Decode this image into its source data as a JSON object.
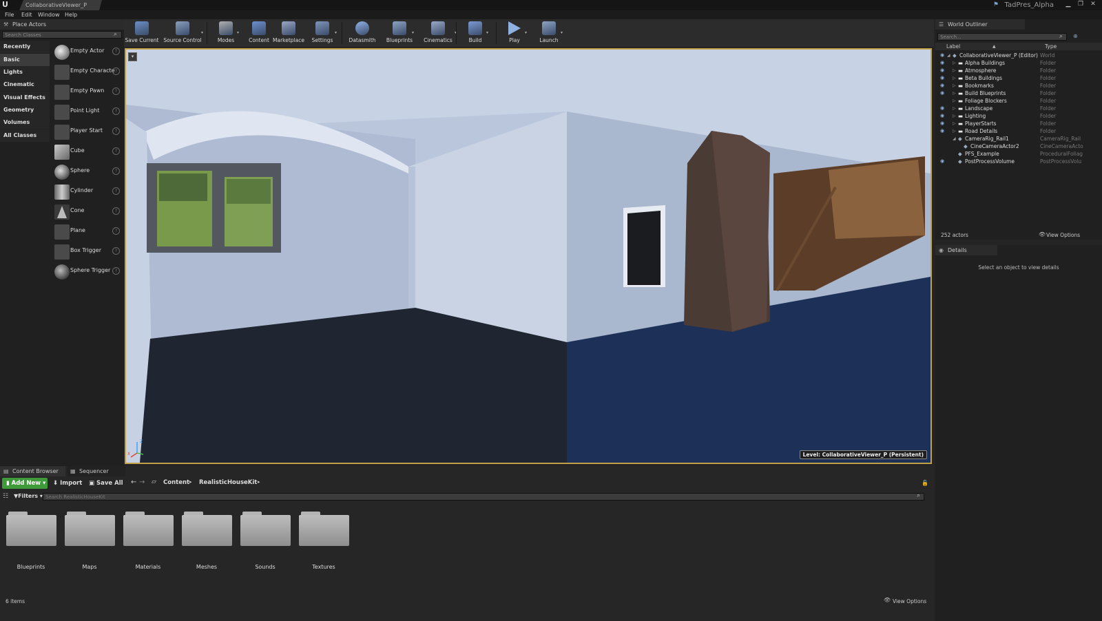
{
  "window": {
    "tab_title": "CollaborativeViewer_P",
    "project_name": "TadPres_Alpha",
    "logo": "U"
  },
  "menu": [
    "File",
    "Edit",
    "Window",
    "Help"
  ],
  "place_actors": {
    "title": "Place Actors",
    "search_placeholder": "Search Classes",
    "categories": [
      "Recently Placed",
      "Basic",
      "Lights",
      "Cinematic",
      "Visual Effects",
      "Geometry",
      "Volumes",
      "All Classes"
    ],
    "active_category": "Basic",
    "items": [
      "Empty Actor",
      "Empty Characte",
      "Empty Pawn",
      "Point Light",
      "Player Start",
      "Cube",
      "Sphere",
      "Cylinder",
      "Cone",
      "Plane",
      "Box Trigger",
      "Sphere Trigger"
    ],
    "help_glyph": "?"
  },
  "toolbar": {
    "buttons": [
      {
        "label": "Save Current",
        "icon": "save-icon",
        "color": "#6b8fc7"
      },
      {
        "label": "Source Control",
        "icon": "source-control-icon",
        "color": "#8aa0c0"
      },
      {
        "label": "Modes",
        "icon": "modes-icon",
        "color": "#b0b0b0"
      },
      {
        "label": "Content",
        "icon": "content-icon",
        "color": "#6d8fd0"
      },
      {
        "label": "Marketplace",
        "icon": "marketplace-icon",
        "color": "#9aa6c6"
      },
      {
        "label": "Settings",
        "icon": "settings-icon",
        "color": "#7f95b8"
      },
      {
        "label": "Datasmith",
        "icon": "datasmith-icon",
        "color": "#8fb2e8"
      },
      {
        "label": "Blueprints",
        "icon": "blueprints-icon",
        "color": "#8ea3c4"
      },
      {
        "label": "Cinematics",
        "icon": "cinematics-icon",
        "color": "#9aa9c8"
      },
      {
        "label": "Build",
        "icon": "build-icon",
        "color": "#7c9ad4"
      },
      {
        "label": "Play",
        "icon": "play-icon",
        "color": "#8fb0e0"
      },
      {
        "label": "Launch",
        "icon": "launch-icon",
        "color": "#8ea3c4"
      }
    ]
  },
  "viewport": {
    "level_label": "Level:  CollaborativeViewer_P (Persistent)",
    "axis_z": "Z",
    "axis_x": "X"
  },
  "outliner": {
    "title": "World Outliner",
    "search_placeholder": "Search...",
    "col_label": "Label",
    "col_type": "Type",
    "rows": [
      {
        "label": "CollaborativeViewer_P (Editor)",
        "type": "World",
        "indent": 0,
        "eye": true,
        "expander": "◢"
      },
      {
        "label": "Alpha Buildings",
        "type": "Folder",
        "indent": 1,
        "eye": true,
        "expander": "▷"
      },
      {
        "label": "Atmosphere",
        "type": "Folder",
        "indent": 1,
        "eye": true,
        "expander": "▷"
      },
      {
        "label": "Beta Buildings",
        "type": "Folder",
        "indent": 1,
        "eye": true,
        "expander": "▷"
      },
      {
        "label": "Bookmarks",
        "type": "Folder",
        "indent": 1,
        "eye": true,
        "expander": "▷"
      },
      {
        "label": "Build Blueprints",
        "type": "Folder",
        "indent": 1,
        "eye": true,
        "expander": "▷"
      },
      {
        "label": "Foliage Blockers",
        "type": "Folder",
        "indent": 1,
        "eye": false,
        "expander": "▷"
      },
      {
        "label": "Landscape",
        "type": "Folder",
        "indent": 1,
        "eye": true,
        "expander": "▷"
      },
      {
        "label": "Lighting",
        "type": "Folder",
        "indent": 1,
        "eye": true,
        "expander": "▷"
      },
      {
        "label": "PlayerStarts",
        "type": "Folder",
        "indent": 1,
        "eye": true,
        "expander": "▷"
      },
      {
        "label": "Road Details",
        "type": "Folder",
        "indent": 1,
        "eye": true,
        "expander": "▷"
      },
      {
        "label": "CameraRig_Rail1",
        "type": "CameraRig_Rail",
        "indent": 1,
        "eye": false,
        "expander": "◢"
      },
      {
        "label": "CineCameraActor2",
        "type": "CineCameraActo",
        "indent": 2,
        "eye": false,
        "expander": ""
      },
      {
        "label": "PFS_Example",
        "type": "ProceduralFoliag",
        "indent": 1,
        "eye": false,
        "expander": ""
      },
      {
        "label": "PostProcessVolume",
        "type": "PostProcessVolu",
        "indent": 1,
        "eye": true,
        "expander": ""
      }
    ],
    "actor_count": "252 actors",
    "view_options": "View Options"
  },
  "details": {
    "title": "Details",
    "empty_message": "Select an object to view details"
  },
  "content_browser": {
    "tabs": [
      "Content Browser",
      "Sequencer"
    ],
    "add_new": "Add New",
    "import": "Import",
    "save_all": "Save All",
    "path": [
      "Content",
      "RealisticHouseKit"
    ],
    "filters": "Filters",
    "search_placeholder": "Search RealisticHouseKit",
    "folders": [
      "Blueprints",
      "Maps",
      "Materials",
      "Meshes",
      "Sounds",
      "Textures"
    ],
    "item_count": "6 items",
    "view_options": "View Options"
  }
}
